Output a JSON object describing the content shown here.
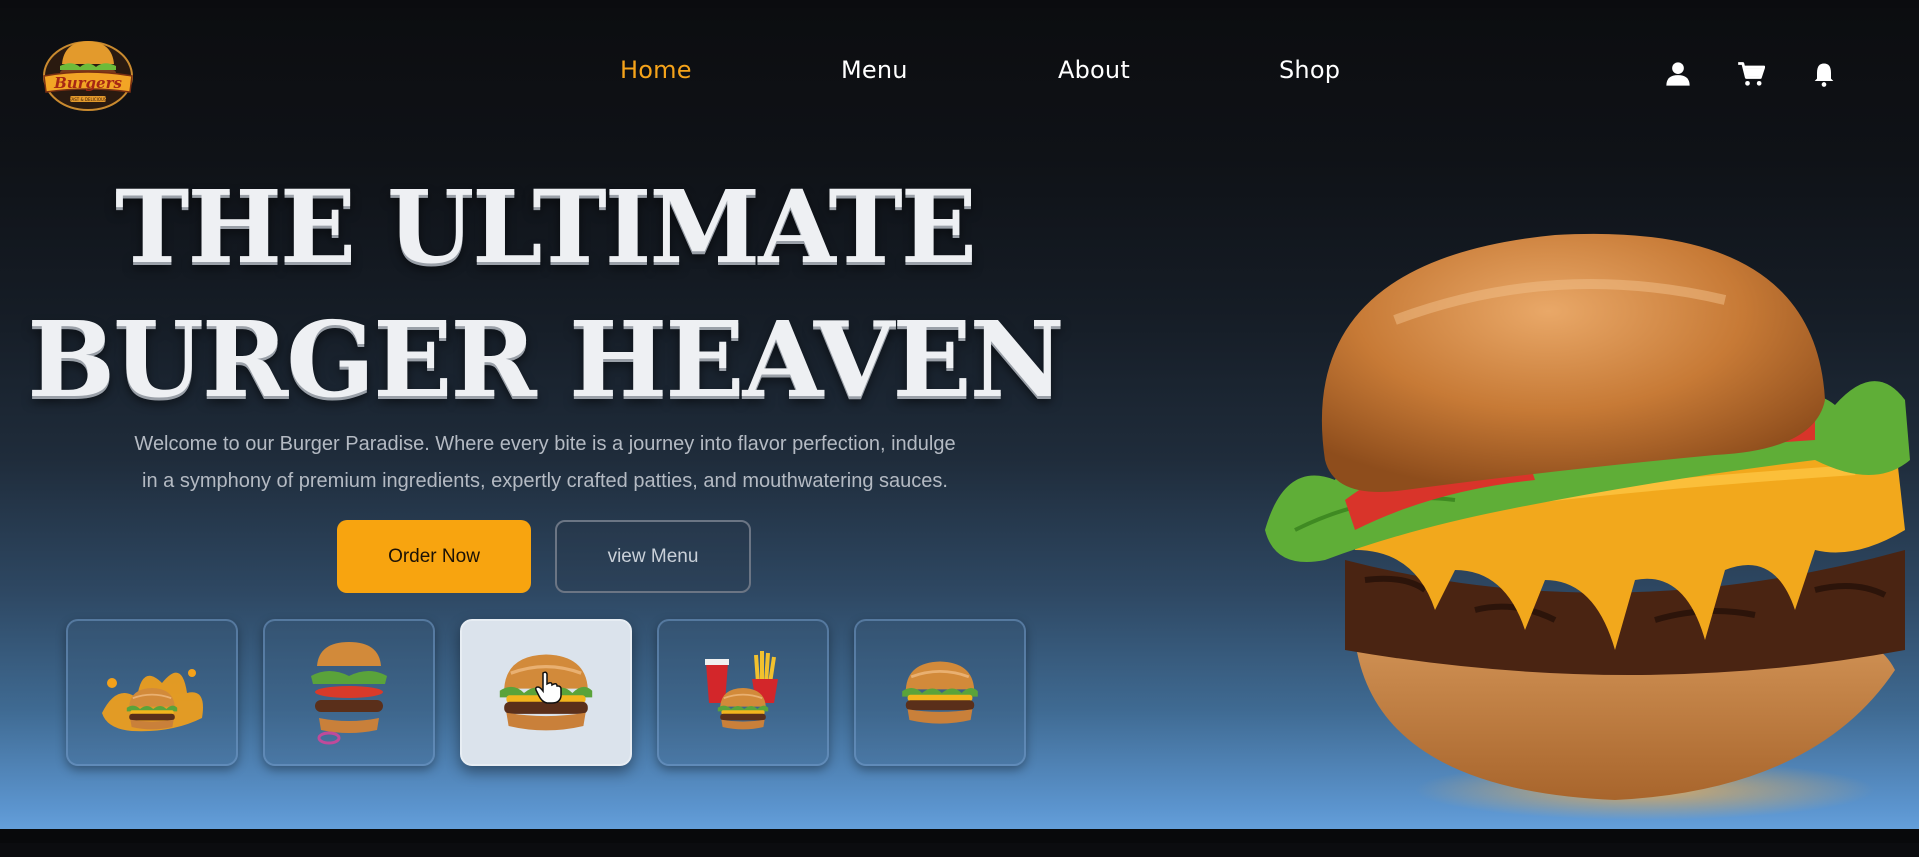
{
  "brand": {
    "logo_text": "Burgers",
    "logo_subtext": "FAST & DELICIOUS"
  },
  "nav": {
    "items": [
      {
        "label": "Home",
        "active": true
      },
      {
        "label": "Menu",
        "active": false
      },
      {
        "label": "About",
        "active": false
      },
      {
        "label": "Shop",
        "active": false
      }
    ]
  },
  "header_icons": [
    "user-icon",
    "cart-icon",
    "bell-icon"
  ],
  "hero": {
    "title_line1": "THE ULTIMATE",
    "title_line2": "BURGER HEAVEN",
    "description_line1": "Welcome to our Burger Paradise. Where every bite is a journey into flavor perfection, indulge",
    "description_line2": "in a symphony of premium ingredients, expertly crafted patties, and mouthwatering sauces.",
    "primary_button": "Order Now",
    "secondary_button": "view Menu"
  },
  "thumbnails": [
    {
      "name": "cheese-splash-burger",
      "selected": false
    },
    {
      "name": "floating-ingredients-burger",
      "selected": false
    },
    {
      "name": "classic-cheeseburger",
      "selected": true
    },
    {
      "name": "burger-combo-meal",
      "selected": false
    },
    {
      "name": "double-burger",
      "selected": false
    }
  ],
  "colors": {
    "accent": "#f5a31a",
    "button_primary": "#f8a40f",
    "text": "#ffffff",
    "muted_text": "#b4bac3"
  }
}
